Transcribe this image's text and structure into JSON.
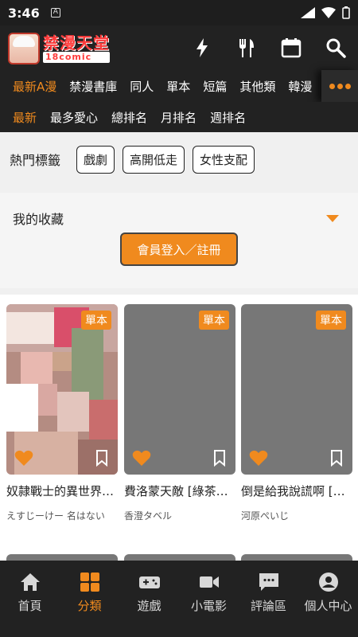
{
  "status": {
    "time": "3:46",
    "notif_icon": "A"
  },
  "app": {
    "logo_line1": "禁漫天堂",
    "logo_line2": "18comic"
  },
  "colors": {
    "accent": "#f08a1e",
    "bar": "#222222",
    "cover_placeholder": "#777777"
  },
  "category_tabs": [
    {
      "label": "最新A漫",
      "active": true
    },
    {
      "label": "禁漫書庫"
    },
    {
      "label": "同人"
    },
    {
      "label": "單本"
    },
    {
      "label": "短篇"
    },
    {
      "label": "其他類"
    },
    {
      "label": "韓漫"
    }
  ],
  "sort_tabs": [
    {
      "label": "最新",
      "active": true
    },
    {
      "label": "最多愛心"
    },
    {
      "label": "總排名"
    },
    {
      "label": "月排名"
    },
    {
      "label": "週排名"
    }
  ],
  "hot_tags": {
    "label": "熱門標籤",
    "tags": [
      "戲劇",
      "高開低走",
      "女性支配"
    ]
  },
  "favorites": {
    "title": "我的收藏",
    "login_button": "會員登入／註冊"
  },
  "comics": [
    {
      "badge": "單本",
      "title": "奴隷戰士的異世界…",
      "author": "えすじーけー 名はない"
    },
    {
      "badge": "單本",
      "title": "費洛蒙天敵 [綠茶…",
      "author": "香澄タベル"
    },
    {
      "badge": "單本",
      "title": "倒是給我說謊啊 […",
      "author": "河原ぺいじ"
    }
  ],
  "bottom_nav": [
    {
      "label": "首頁",
      "icon": "home-icon"
    },
    {
      "label": "分類",
      "icon": "grid-icon",
      "active": true
    },
    {
      "label": "遊戲",
      "icon": "gamepad-icon"
    },
    {
      "label": "小電影",
      "icon": "video-icon"
    },
    {
      "label": "評論區",
      "icon": "chat-icon"
    },
    {
      "label": "個人中心",
      "icon": "person-icon"
    }
  ]
}
